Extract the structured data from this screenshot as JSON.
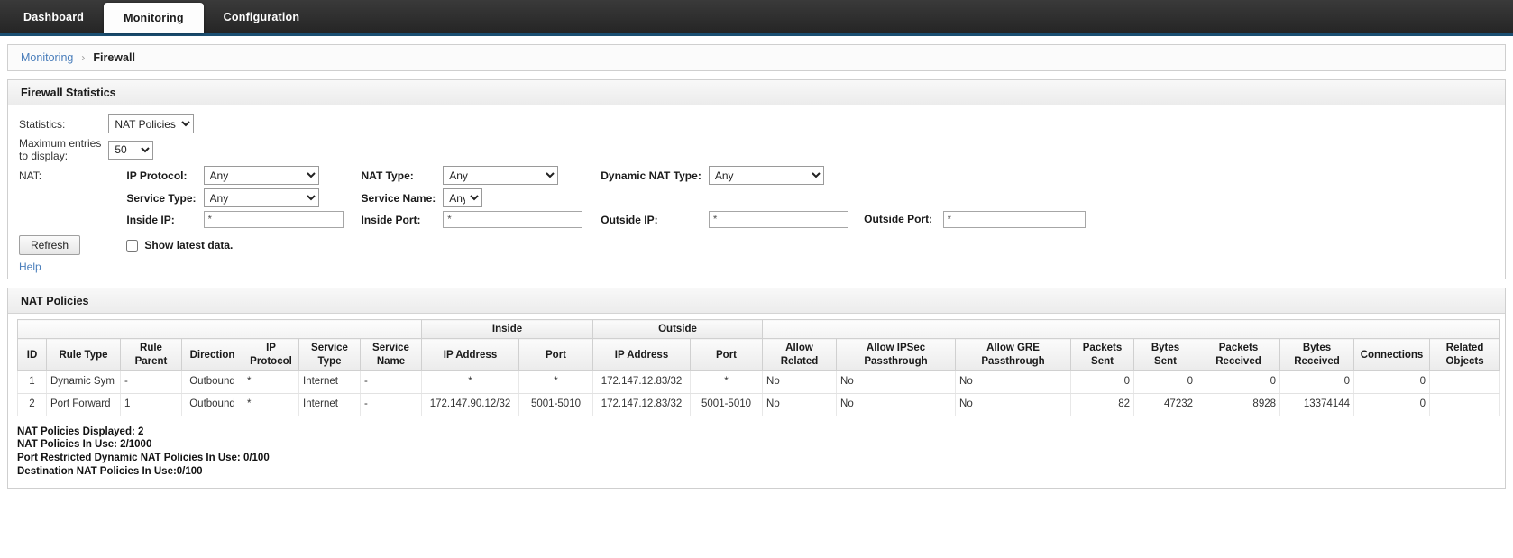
{
  "nav": {
    "tabs": [
      {
        "label": "Dashboard",
        "active": false
      },
      {
        "label": "Monitoring",
        "active": true
      },
      {
        "label": "Configuration",
        "active": false
      }
    ]
  },
  "breadcrumb": {
    "parent": "Monitoring",
    "separator": "›",
    "current": "Firewall"
  },
  "stats_panel": {
    "title": "Firewall Statistics",
    "statistics_label": "Statistics:",
    "statistics_value": "NAT Policies",
    "statistics_options": [
      "NAT Policies"
    ],
    "max_entries_label_line1": "Maximum entries",
    "max_entries_label_line2": "to display:",
    "max_entries_value": "50",
    "max_entries_options": [
      "50"
    ],
    "nat_label": "NAT:",
    "ip_protocol_label": "IP Protocol:",
    "ip_protocol_value": "Any",
    "nat_type_label": "NAT Type:",
    "nat_type_value": "Any",
    "dynamic_nat_type_label": "Dynamic NAT Type:",
    "dynamic_nat_type_value": "Any",
    "service_type_label": "Service Type:",
    "service_type_value": "Any",
    "service_name_label": "Service Name:",
    "service_name_value": "Any",
    "inside_ip_label": "Inside IP:",
    "inside_ip_value": "*",
    "inside_port_label": "Inside Port:",
    "inside_port_value": "*",
    "outside_ip_label": "Outside IP:",
    "outside_ip_value": "*",
    "outside_port_label": "Outside Port:",
    "outside_port_value": "*",
    "refresh_label": "Refresh",
    "show_latest_label": "Show latest data.",
    "show_latest_checked": false,
    "help_label": "Help"
  },
  "table_panel": {
    "title": "NAT Policies",
    "group_headers": {
      "inside": "Inside",
      "outside": "Outside"
    },
    "columns": [
      "ID",
      "Rule Type",
      "Rule\nParent",
      "Direction",
      "IP\nProtocol",
      "Service\nType",
      "Service\nName",
      "IP Address",
      "Port",
      "IP Address",
      "Port",
      "Allow\nRelated",
      "Allow IPSec\nPassthrough",
      "Allow GRE\nPassthrough",
      "Packets\nSent",
      "Bytes\nSent",
      "Packets\nReceived",
      "Bytes\nReceived",
      "Connections",
      "Related\nObjects"
    ],
    "rows": [
      {
        "id": "1",
        "rule_type": "Dynamic Sym",
        "rule_parent": "-",
        "direction": "Outbound",
        "ip_protocol": "*",
        "service_type": "Internet",
        "service_name": "-",
        "inside_ip": "*",
        "inside_port": "*",
        "outside_ip": "172.147.12.83/32",
        "outside_port": "*",
        "allow_related": "No",
        "allow_ipsec": "No",
        "allow_gre": "No",
        "packets_sent": "0",
        "bytes_sent": "0",
        "packets_received": "0",
        "bytes_received": "0",
        "connections": "0",
        "related_objects": ""
      },
      {
        "id": "2",
        "rule_type": "Port Forward",
        "rule_parent": "1",
        "direction": "Outbound",
        "ip_protocol": "*",
        "service_type": "Internet",
        "service_name": "-",
        "inside_ip": "172.147.90.12/32",
        "inside_port": "5001-5010",
        "outside_ip": "172.147.12.83/32",
        "outside_port": "5001-5010",
        "allow_related": "No",
        "allow_ipsec": "No",
        "allow_gre": "No",
        "packets_sent": "82",
        "bytes_sent": "47232",
        "packets_received": "8928",
        "bytes_received": "13374144",
        "connections": "0",
        "related_objects": ""
      }
    ],
    "summary": [
      "NAT Policies Displayed: 2",
      "NAT Policies In Use: 2/1000",
      "Port Restricted Dynamic NAT Policies In Use: 0/100",
      "Destination NAT Policies In Use:0/100"
    ]
  },
  "colors": {
    "nav_background": "#2b2b2b",
    "nav_accent": "#1b4f72",
    "link": "#4a7ebb",
    "panel_header": "#f1f1f1"
  }
}
